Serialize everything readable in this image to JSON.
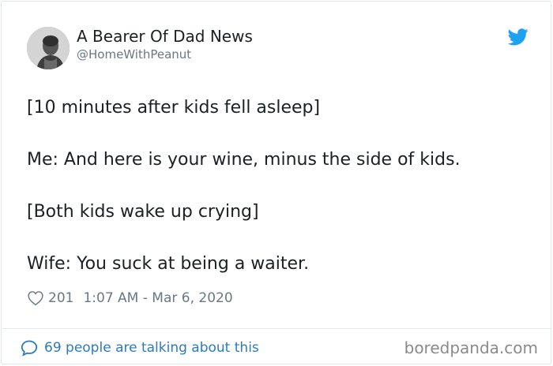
{
  "author": {
    "display_name": "A Bearer Of Dad News",
    "handle": "@HomeWithPeanut"
  },
  "tweet": {
    "lines": [
      "[10 minutes after kids fell asleep]",
      "Me: And here is your wine, minus the side of kids.",
      "[Both kids wake up crying]",
      "Wife: You suck at being a waiter."
    ]
  },
  "meta": {
    "likes": "201",
    "timestamp": "1:07 AM - Mar 6, 2020"
  },
  "footer": {
    "conversation_text": "69 people are talking about this",
    "watermark": "boredpanda.com"
  },
  "icons": {
    "heart": "heart-icon",
    "bubble": "speech-bubble-icon",
    "logo": "twitter-bird-icon"
  },
  "colors": {
    "text": "#1c2022",
    "muted": "#697882",
    "link": "#2b7bb9",
    "twitter_blue": "#1da1f2",
    "border": "#e1e8ed"
  }
}
